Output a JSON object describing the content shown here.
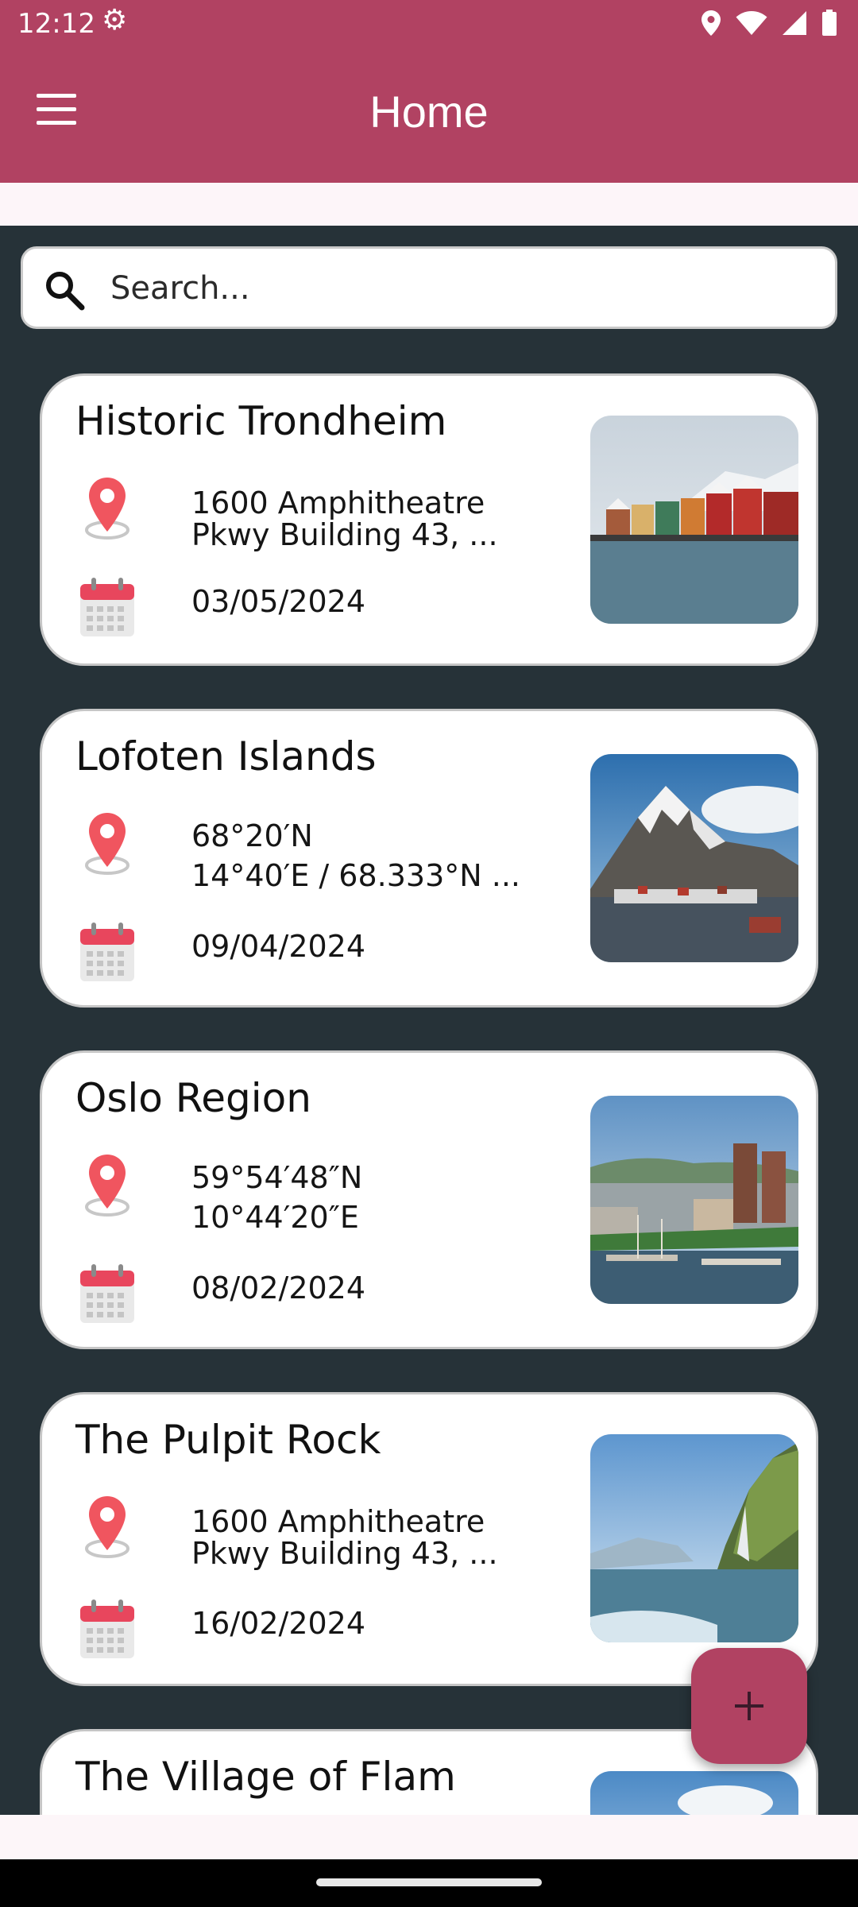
{
  "status_bar": {
    "time": "12:12"
  },
  "app_bar": {
    "title": "Home"
  },
  "search": {
    "placeholder": "Search..."
  },
  "cards": [
    {
      "title": "Historic Trondheim",
      "location_line1": "1600 Amphitheatre",
      "location_line2": "Pkwy Building 43, ...",
      "date": "03/05/2024"
    },
    {
      "title": "Lofoten Islands",
      "location_line1": "68°20′N",
      "location_line2": "14°40′E / 68.333°N ...",
      "date": "09/04/2024"
    },
    {
      "title": "Oslo Region",
      "location_line1": "59°54′48″N",
      "location_line2": "10°44′20″E",
      "date": "08/02/2024"
    },
    {
      "title": "The Pulpit Rock",
      "location_line1": "1600 Amphitheatre",
      "location_line2": "Pkwy Building 43, ...",
      "date": "16/02/2024"
    },
    {
      "title": "The Village of Flam"
    }
  ],
  "icons": {
    "status": [
      "gear-icon",
      "location-icon",
      "wifi-icon",
      "signal-icon",
      "battery-icon"
    ],
    "menu": "menu-icon",
    "search": "search-icon",
    "card_location": "map-pin-icon",
    "card_date": "calendar-icon",
    "fab": "plus-icon"
  },
  "colors": {
    "primary": "#b14262",
    "content_background": "#263238",
    "card_background": "#ffffff",
    "pin": "#f0555f",
    "calendar_header": "#e8465d"
  }
}
